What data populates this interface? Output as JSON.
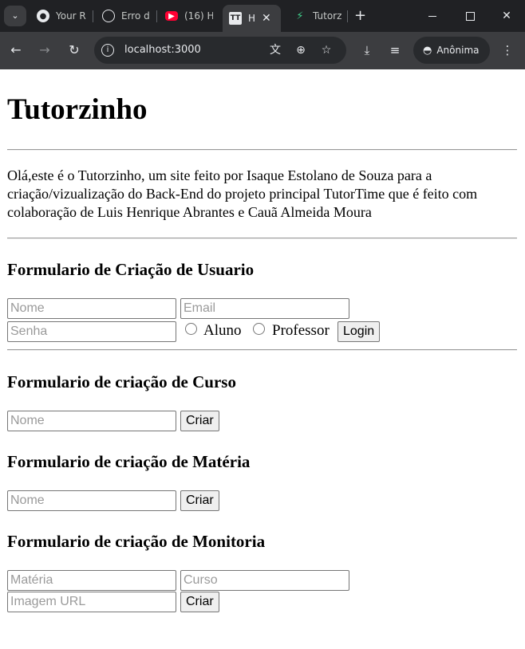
{
  "browser": {
    "tabs": [
      {
        "title": "Your R",
        "icon": "github-icon"
      },
      {
        "title": "Erro d",
        "icon": "chatgpt-icon"
      },
      {
        "title": "(16) H",
        "icon": "youtube-icon"
      },
      {
        "title": "H",
        "icon": "tutor-icon",
        "active": true
      },
      {
        "title": "Tutorz",
        "icon": "vite-icon"
      }
    ],
    "url": "localhost:3000",
    "profile_label": "Anônima"
  },
  "page": {
    "title": "Tutorzinho",
    "intro": "Olá,este é o Tutorzinho, um site feito por Isaque Estolano de Souza para a criação/vizualização do Back-End do projeto principal TutorTime que é feito com colaboração de Luis Henrique Abrantes e Cauã Almeida Moura"
  },
  "forms": {
    "user": {
      "title": "Formulario de Criação de Usuario",
      "name_placeholder": "Nome",
      "email_placeholder": "Email",
      "password_placeholder": "Senha",
      "radio_student": "Aluno",
      "radio_teacher": "Professor",
      "submit": "Login"
    },
    "course": {
      "title": "Formulario de criação de Curso",
      "name_placeholder": "Nome",
      "submit": "Criar"
    },
    "subject": {
      "title": "Formulario de criação de Matéria",
      "name_placeholder": "Nome",
      "submit": "Criar"
    },
    "tutoring": {
      "title": "Formulario de criação de Monitoria",
      "subject_placeholder": "Matéria",
      "course_placeholder": "Curso",
      "image_placeholder": "Imagem URL",
      "submit": "Criar"
    }
  }
}
